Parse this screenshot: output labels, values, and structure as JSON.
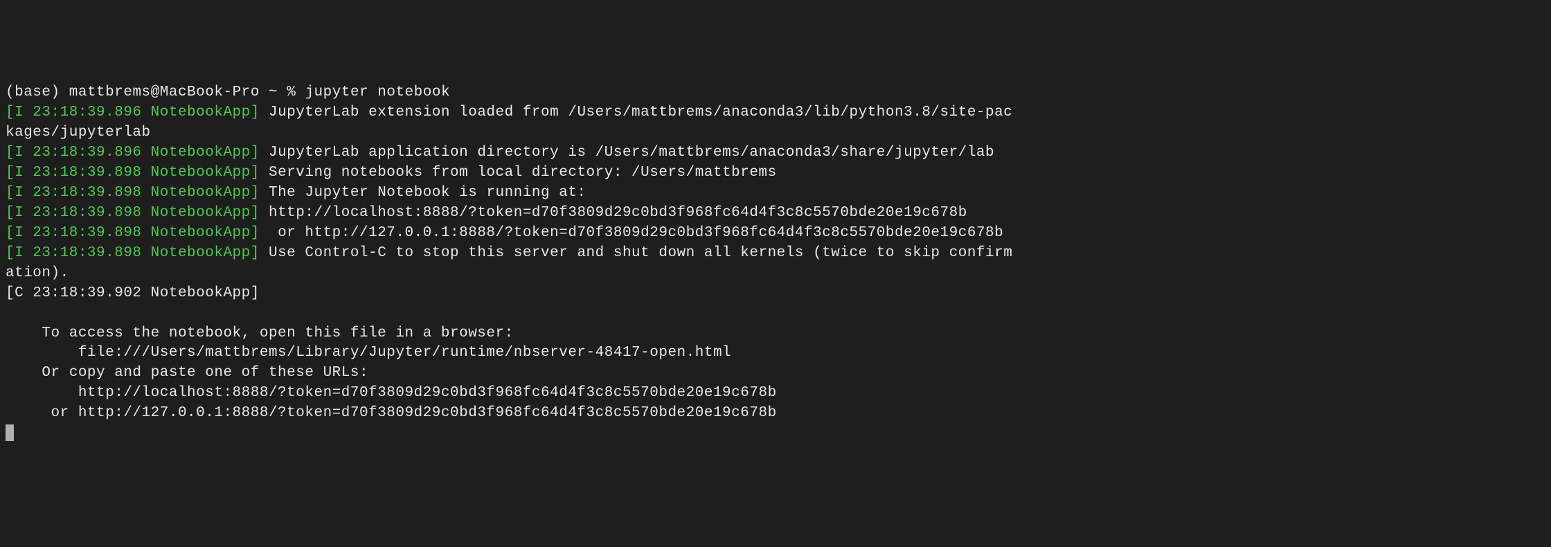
{
  "prompt": {
    "env": "(base)",
    "user_host": "mattbrems@MacBook-Pro",
    "path": "~",
    "symbol": "%",
    "command": "jupyter notebook"
  },
  "lines": [
    {
      "tag": "[I 23:18:39.896 NotebookApp]",
      "text": "JupyterLab extension loaded from /Users/mattbrems/anaconda3/lib/python3.8/site-pac",
      "continuation": "kages/jupyterlab"
    },
    {
      "tag": "[I 23:18:39.896 NotebookApp]",
      "text": "JupyterLab application directory is /Users/mattbrems/anaconda3/share/jupyter/lab"
    },
    {
      "tag": "[I 23:18:39.898 NotebookApp]",
      "text": "Serving notebooks from local directory: /Users/mattbrems"
    },
    {
      "tag": "[I 23:18:39.898 NotebookApp]",
      "text": "The Jupyter Notebook is running at:"
    },
    {
      "tag": "[I 23:18:39.898 NotebookApp]",
      "text": "http://localhost:8888/?token=d70f3809d29c0bd3f968fc64d4f3c8c5570bde20e19c678b"
    },
    {
      "tag": "[I 23:18:39.898 NotebookApp]",
      "text": " or http://127.0.0.1:8888/?token=d70f3809d29c0bd3f968fc64d4f3c8c5570bde20e19c678b"
    },
    {
      "tag": "[I 23:18:39.898 NotebookApp]",
      "text": "Use Control-C to stop this server and shut down all kernels (twice to skip confirm",
      "continuation": "ation)."
    }
  ],
  "critical_tag": "[C 23:18:39.902 NotebookApp]",
  "access_block": {
    "l1": "    To access the notebook, open this file in a browser:",
    "l2": "        file:///Users/mattbrems/Library/Jupyter/runtime/nbserver-48417-open.html",
    "l3": "    Or copy and paste one of these URLs:",
    "l4": "        http://localhost:8888/?token=d70f3809d29c0bd3f968fc64d4f3c8c5570bde20e19c678b",
    "l5": "     or http://127.0.0.1:8888/?token=d70f3809d29c0bd3f968fc64d4f3c8c5570bde20e19c678b"
  }
}
